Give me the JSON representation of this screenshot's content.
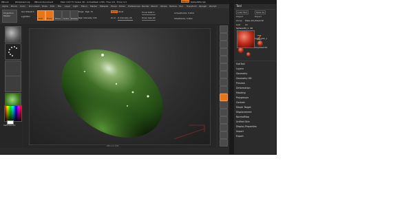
{
  "title_bar": {
    "app": "ZBrush",
    "segments": [
      "ZBrush",
      "ZClipboard.zip",
      "ZBrush Document",
      "Mem 4.87 F.1 Scalar 36 - ActiveMesh 2.5M - Free 4.8 - Timer 4.3"
    ],
    "right": [
      "Menus",
      "DefaultZScript"
    ]
  },
  "menu": [
    "Alpha",
    "Brush",
    "Color",
    "Document",
    "Draw",
    "Edit",
    "File",
    "Layer",
    "Light",
    "Macro",
    "Marker",
    "Material",
    "Movie",
    "Picker",
    "Preferences",
    "Render",
    "Stencil",
    "Stroke",
    "Texture",
    "Tool",
    "Transform",
    "Zplugin",
    "Zscript"
  ],
  "toolbar": {
    "projection_master": "Projection Master",
    "quicksketch": "QuickSketch",
    "lightbox": "LightBox",
    "edit": "Edit",
    "draw": "Draw",
    "move": "Move",
    "scale": "Scale",
    "rotate": "Rotate",
    "mrgb": "Mrgb",
    "rgb": "Rgb",
    "m": "M",
    "rgb_intensity": "Rgb Intensity 100",
    "zadd": "Zadd",
    "zsub": "Zsub",
    "zcut": "Zcut",
    "z_intensity": "Z Intensity 25",
    "focal_shift": "Focal Shift 0",
    "draw_size": "Draw Size 64",
    "active_points": "ActivePoints: 5,810",
    "total_points": "TotalPoints: 5,810"
  },
  "shelf": {
    "color_label": "SwitchColor"
  },
  "canvas": {
    "footer": "ZBrush 4R2"
  },
  "right_shelf": [
    "Bpr",
    "SPix",
    "Scroll",
    "Zoom",
    "Actual",
    "AAHalf",
    "Persp",
    "Floor",
    "Local",
    "L.Sym",
    "Frame",
    "Move",
    "Scale",
    "Rotate",
    "PolyF",
    "Transp",
    "Ghost",
    "Solo"
  ],
  "tool_panel": {
    "header": "Tool",
    "buttons": [
      "Load Tool",
      "Save As",
      "Import",
      "Export",
      "Clone",
      "Make PolyMesh3D",
      "GoZ",
      "All"
    ],
    "active_tool": "Sphere3D_1: 48",
    "thumbs": [
      "Sphere3D_1",
      "Cylinder3D",
      "PolyMesh3D",
      "SimpleBrush"
    ],
    "sections": [
      "SubTool",
      "Layers",
      "Geometry",
      "Geometry HD",
      "Preview",
      "Deformation",
      "Masking",
      "Polygroups",
      "Contact",
      "Morph Target",
      "Displacement",
      "NormalMap",
      "Unified Skin",
      "Display Properties",
      "Import",
      "Export"
    ]
  },
  "colors": {
    "accent": "#e8751a",
    "background": "#2a2a2a",
    "mesh": "#3d7a2a"
  }
}
